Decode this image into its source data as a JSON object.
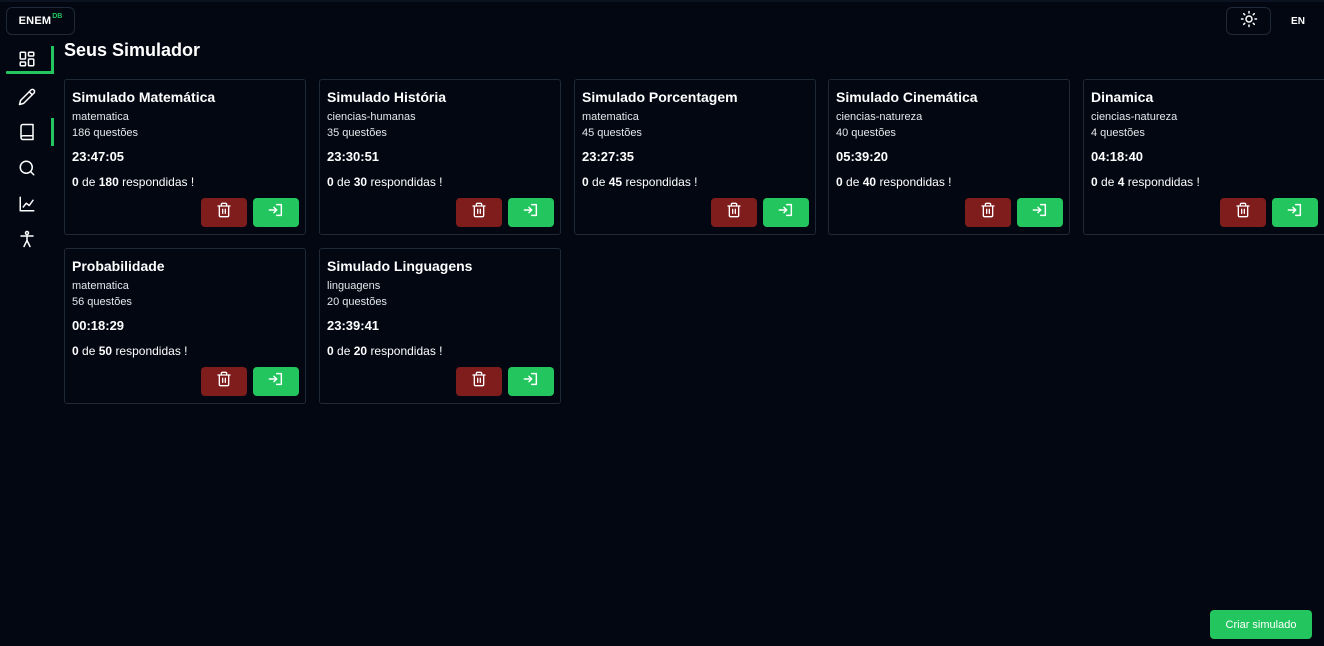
{
  "header": {
    "logo_text": "ENEM",
    "logo_sup": "DB",
    "lang_label": "EN"
  },
  "sidebar": {
    "items": [
      {
        "name": "dashboard-icon"
      },
      {
        "name": "pencil-icon"
      },
      {
        "name": "book-icon"
      },
      {
        "name": "search-icon"
      },
      {
        "name": "chart-line-icon"
      },
      {
        "name": "accessibility-icon"
      }
    ]
  },
  "page": {
    "title": "Seus Simulador"
  },
  "cards": [
    {
      "title": "Simulado Matemática",
      "category": "matematica",
      "questions": "186 questões",
      "time": "23:47:05",
      "answered": "0",
      "of": "de",
      "total": "180",
      "suffix": "respondidas !"
    },
    {
      "title": "Simulado História",
      "category": "ciencias-humanas",
      "questions": "35 questões",
      "time": "23:30:51",
      "answered": "0",
      "of": "de",
      "total": "30",
      "suffix": "respondidas !"
    },
    {
      "title": "Simulado Porcentagem",
      "category": "matematica",
      "questions": "45 questões",
      "time": "23:27:35",
      "answered": "0",
      "of": "de",
      "total": "45",
      "suffix": "respondidas !"
    },
    {
      "title": "Simulado Cinemática",
      "category": "ciencias-natureza",
      "questions": "40 questões",
      "time": "05:39:20",
      "answered": "0",
      "of": "de",
      "total": "40",
      "suffix": "respondidas !"
    },
    {
      "title": "Dinamica",
      "category": "ciencias-natureza",
      "questions": "4 questões",
      "time": "04:18:40",
      "answered": "0",
      "of": "de",
      "total": "4",
      "suffix": "respondidas !"
    },
    {
      "title": "Probabilidade",
      "category": "matematica",
      "questions": "56 questões",
      "time": "00:18:29",
      "answered": "0",
      "of": "de",
      "total": "50",
      "suffix": "respondidas !"
    },
    {
      "title": "Simulado Linguagens",
      "category": "linguagens",
      "questions": "20 questões",
      "time": "23:39:41",
      "answered": "0",
      "of": "de",
      "total": "20",
      "suffix": "respondidas !"
    }
  ],
  "actions": {
    "create_label": "Criar simulado"
  },
  "colors": {
    "background": "#030712",
    "accent": "#22c55e",
    "danger": "#7f1d1d",
    "border": "#1f2937"
  }
}
